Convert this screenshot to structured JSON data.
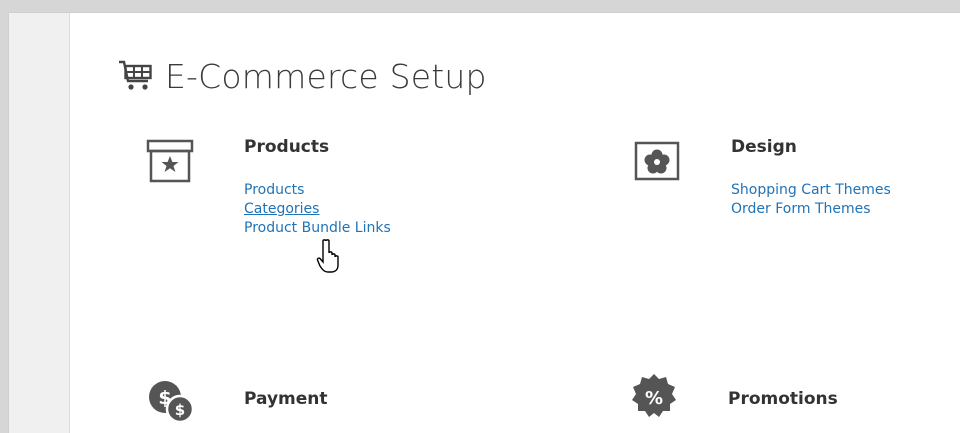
{
  "page": {
    "title": "E-Commerce Setup"
  },
  "sections": {
    "products": {
      "heading": "Products",
      "links": [
        "Products",
        "Categories",
        "Product Bundle Links"
      ]
    },
    "design": {
      "heading": "Design",
      "links": [
        "Shopping Cart Themes",
        "Order Form Themes"
      ]
    },
    "payment": {
      "heading": "Payment"
    },
    "promotions": {
      "heading": "Promotions"
    }
  },
  "icons": {
    "title": "shopping-cart-icon",
    "products": "archive-box-star-icon",
    "design": "flower-icon",
    "payment": "coins-dollar-icon",
    "promotions": "percent-badge-icon",
    "cursor": "hand-pointer-cursor"
  },
  "colors": {
    "link": "#1f73b7",
    "heading": "#333333",
    "icon": "#555555"
  }
}
